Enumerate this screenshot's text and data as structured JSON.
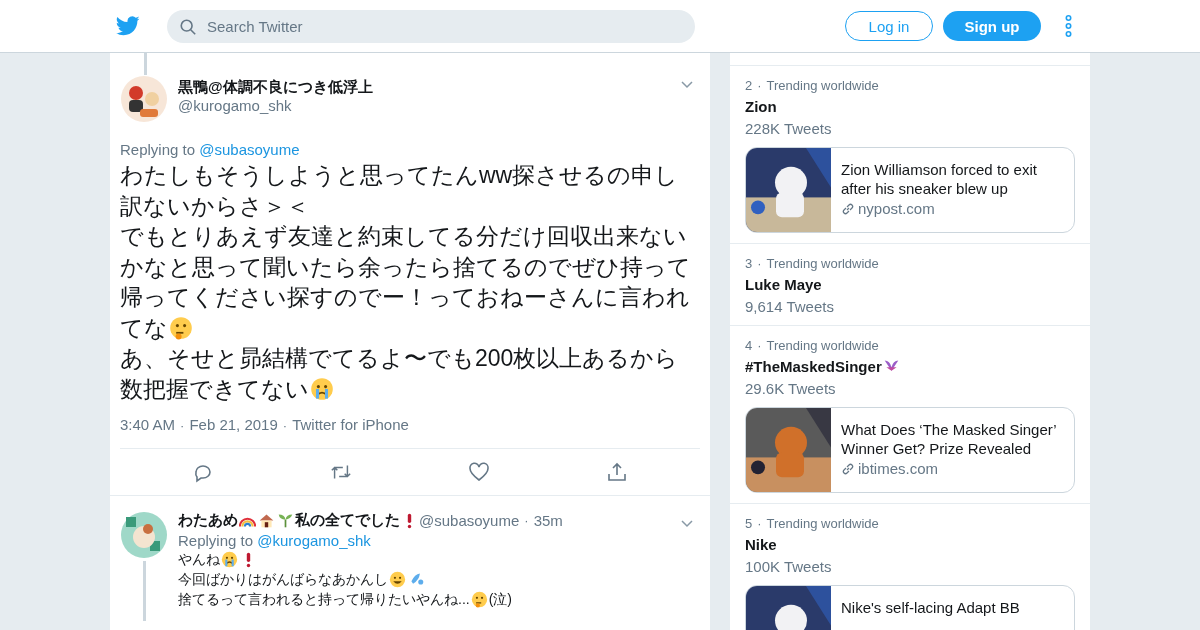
{
  "header": {
    "search": {
      "placeholder": "Search Twitter"
    },
    "login": "Log in",
    "signup": "Sign up"
  },
  "tweet": {
    "name": "黒鴨@体調不良につき低浮上",
    "handle": "@kurogamo_shk",
    "replying_label": "Replying to",
    "replying_to": "@subasoyume",
    "lines": [
      [
        {
          "kind": "text",
          "text": "わたしもそうしようと思ってたんww探させるの申し"
        }
      ],
      [
        {
          "kind": "text",
          "text": "訳ないからさ＞＜"
        }
      ],
      [
        {
          "kind": "text",
          "text": "でもとりあえず友達と約束してる分だけ回収出来ない"
        }
      ],
      [
        {
          "kind": "text",
          "text": "かなと思って聞いたら余ったら捨てるのでぜひ持って"
        }
      ],
      [
        {
          "kind": "text",
          "text": "帰ってください探すのでー！っておねーさんに言われ"
        }
      ],
      [
        {
          "kind": "text",
          "text": "てな"
        },
        {
          "kind": "think"
        }
      ],
      [
        {
          "kind": "text",
          "text": "あ、そせと昴結構でてるよ〜でも200枚以上あるから"
        }
      ],
      [
        {
          "kind": "text",
          "text": "数把握できてない"
        },
        {
          "kind": "cry"
        }
      ]
    ],
    "time": "3:40 AM",
    "separators": [
      "·",
      "·"
    ],
    "date": "Feb 21, 2019",
    "source": "Twitter for iPhone"
  },
  "reply": {
    "name": [
      {
        "kind": "text",
        "text": "わたあめ"
      },
      {
        "kind": "rainbow"
      },
      {
        "kind": "house"
      },
      {
        "kind": "sprout"
      },
      {
        "kind": "text",
        "text": "私の全てでした"
      },
      {
        "kind": "bang"
      }
    ],
    "handle": "@subasoyume",
    "separator": "·",
    "age": "35m",
    "replying_label": "Replying to",
    "replying_to": "@kurogamo_shk",
    "lines": [
      [
        {
          "kind": "text",
          "text": "やんね"
        },
        {
          "kind": "cry"
        },
        {
          "kind": "bang"
        }
      ],
      [
        {
          "kind": "text",
          "text": "今回ばかりはがんばらなあかんし"
        },
        {
          "kind": "laugh"
        },
        {
          "kind": "drops"
        }
      ],
      [
        {
          "kind": "text",
          "text": "捨てるって言われると持って帰りたいやんね..."
        },
        {
          "kind": "think"
        },
        {
          "kind": "text",
          "text": "(泣)"
        }
      ]
    ]
  },
  "trends": [
    {
      "rank": "2",
      "separator": "·",
      "context": "Trending worldwide",
      "name": "Zion",
      "emoji": false,
      "count": "228K Tweets",
      "card": {
        "title": "Zion Williamson forced to exit after his sneaker blew up",
        "domain": "nypost.com"
      }
    },
    {
      "rank": "3",
      "separator": "·",
      "context": "Trending worldwide",
      "name": "Luke Maye",
      "emoji": false,
      "count": "9,614 Tweets"
    },
    {
      "rank": "4",
      "separator": "·",
      "context": "Trending worldwide",
      "name": "#TheMaskedSinger",
      "emoji": true,
      "count": "29.6K Tweets",
      "card": {
        "title": "What Does ‘The Masked Singer’ Winner Get? Prize Revealed",
        "domain": "ibtimes.com"
      }
    },
    {
      "rank": "5",
      "separator": "·",
      "context": "Trending worldwide",
      "name": "Nike",
      "emoji": false,
      "count": "100K Tweets",
      "card": {
        "title": "Nike's self-lacing Adapt BB"
      }
    }
  ]
}
